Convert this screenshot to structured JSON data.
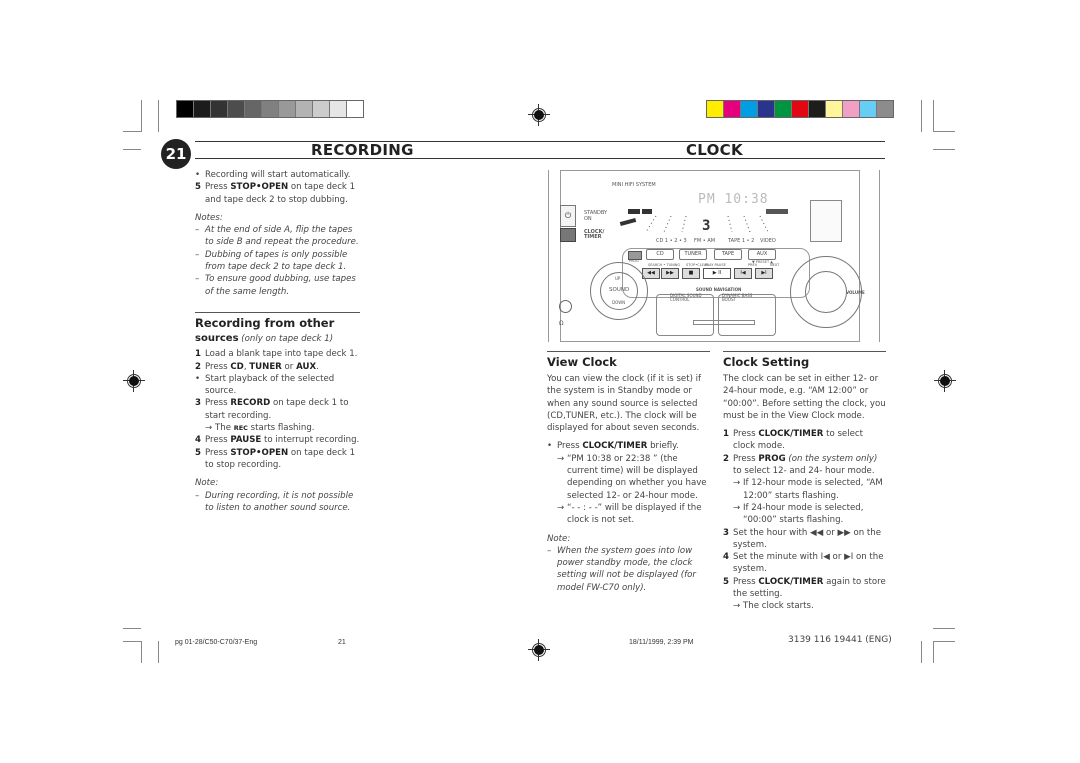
{
  "print_marks": {
    "gray_swatches": [
      "#000000",
      "#1c1c1c",
      "#333333",
      "#4d4d4d",
      "#666666",
      "#808080",
      "#999999",
      "#b3b3b3",
      "#cccccc",
      "#e6e6e6",
      "#ffffff"
    ],
    "color_swatches": [
      "#ffed00",
      "#e6007e",
      "#009fe3",
      "#29348c",
      "#009640",
      "#e30613",
      "#1d1d1b",
      "#fff59b",
      "#f29fc5",
      "#66cdf5",
      "#8c8c8c"
    ]
  },
  "header": {
    "page_number": "21",
    "left_title": "RECORDING",
    "right_title": "CLOCK"
  },
  "left_column": {
    "intro_bullet": "Recording will start automatically.",
    "step5_num": "5",
    "step5_pre": "Press ",
    "step5_bold": "STOP•OPEN",
    "step5_post": " on tape deck 1 and tape deck 2 to stop dubbing.",
    "notes_label": "Notes:",
    "notes": [
      "At the end of side A, flip the tapes to side B and repeat the procedure.",
      "Dubbing of tapes is only possible from tape deck 2 to tape deck 1.",
      "To ensure good dubbing, use tapes of the same length."
    ],
    "section_title_1": "Recording from other",
    "section_title_2": "sources",
    "section_title_note": "(only on tape deck 1)",
    "steps": {
      "s1_num": "1",
      "s1_text": "Load a blank tape into tape deck 1.",
      "s2_num": "2",
      "s2_pre": "Press ",
      "s2_b1": "CD",
      "s2_mid1": ", ",
      "s2_b2": "TUNER",
      "s2_mid2": " or ",
      "s2_b3": "AUX",
      "s2_post": ".",
      "s2_bullet": "Start playback of the selected source.",
      "s3_num": "3",
      "s3_pre": "Press ",
      "s3_bold": "RECORD",
      "s3_post": " on tape deck 1 to start recording.",
      "s3_arrow_pre": "The ",
      "s3_arrow_bold": "REC",
      "s3_arrow_post": " starts flashing.",
      "s4_num": "4",
      "s4_pre": "Press ",
      "s4_bold": "PAUSE",
      "s4_post": " to interrupt recording.",
      "s5_num": "5",
      "s5_pre": "Press ",
      "s5_bold": "STOP•OPEN",
      "s5_post": " on tape deck 1 to stop recording."
    },
    "note_label": "Note:",
    "note": "During recording, it is not possible to listen to another sound source."
  },
  "device": {
    "brand_label": "MINI HIFI SYSTEM",
    "standby_label": "STANDBY",
    "on_label": "ON",
    "clock_timer_label": "CLOCK/\nTIMER",
    "lcd_time": "PM 10:38",
    "lcd_disc": "3",
    "source_labels": [
      "CD 1 • 2 • 3",
      "FM • AM",
      "TAPE 1 • 2",
      "VIDEO"
    ],
    "source_buttons": [
      "CD",
      "TUNER",
      "TAPE",
      "AUX"
    ],
    "prog_label": "PROG",
    "preset_label": "▼ PRESET ▲",
    "transport_labels": [
      "SEARCH • TUNING",
      "STOP•CLEAN",
      "PLAY PAUSE",
      "PREV",
      "NEXT"
    ],
    "transport_icons": [
      "◀◀",
      "▶▶",
      "■",
      "▶ II",
      "I◀",
      "▶I"
    ],
    "sound_label": "SOUND",
    "up_label": "UP",
    "down_label": "DOWN",
    "sound_nav_label": "SOUND NAVIGATION",
    "dsc_label": "DIGITAL SOUND\nCONTROL",
    "dbb_label": "DYNAMIC BASS\nBOOST",
    "volume_label": "VOLUME",
    "headphone_icon": "Ω"
  },
  "view_clock": {
    "title": "View Clock",
    "body": "You can view the clock (if it is set) if the system is in Standby mode or when any sound source is selected (CD,TUNER, etc.). The clock will be displayed for about seven seconds.",
    "bullet_pre": "Press ",
    "bullet_bold": "CLOCK/TIMER",
    "bullet_post": " briefly.",
    "arrow1": "“PM  10:38 or 22:38 ” (the current time) will be displayed depending on whether you have selected  12- or 24-hour mode.",
    "arrow2": "“- - : - -” will be displayed if the clock is not set.",
    "note_label": "Note:",
    "note": "When the system goes into low power standby mode, the clock setting will not be displayed (for model FW-C70 only)."
  },
  "clock_setting": {
    "title": "Clock Setting",
    "body": "The clock can be set in either 12- or 24-hour mode, e.g. “AM  12:00” or “00:00”. Before setting the clock, you must be in the View Clock mode.",
    "s1_num": "1",
    "s1_pre": "Press ",
    "s1_bold": "CLOCK/TIMER",
    "s1_post": " to select clock mode.",
    "s2_num": "2",
    "s2_pre": "Press ",
    "s2_bold": "PROG",
    "s2_italic": " (on the system only)",
    "s2_post": " to select 12- and 24- hour mode.",
    "s2_arrow1": "If 12-hour mode is selected, “AM  12:00” starts flashing.",
    "s2_arrow2": "If 24-hour mode is selected, “00:00” starts flashing.",
    "s3_num": "3",
    "s3_text": "Set the hour with ◀◀ or ▶▶ on the system.",
    "s4_num": "4",
    "s4_text": "Set the minute with I◀ or ▶I on the system.",
    "s5_num": "5",
    "s5_pre": "Press ",
    "s5_bold": "CLOCK/TIMER",
    "s5_post": " again to store the setting.",
    "s5_arrow": "The clock starts."
  },
  "footer": {
    "file": "pg 01-28/C50-C70/37-Eng",
    "page": "21",
    "datetime": "18/11/1999, 2:39 PM",
    "code": "3139 116 19441 (ENG)"
  },
  "symbols": {
    "bullet": "•",
    "arrow": "→",
    "dash": "–"
  }
}
